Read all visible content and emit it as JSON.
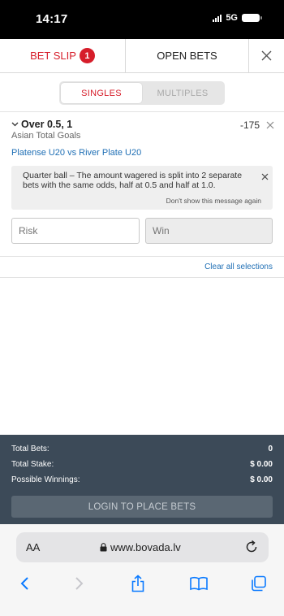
{
  "status_bar": {
    "time": "14:17",
    "network": "5G"
  },
  "tabs": {
    "bet_slip_label": "BET SLIP",
    "bet_slip_count": "1",
    "open_bets_label": "OPEN BETS"
  },
  "bet_type": {
    "singles_label": "SINGLES",
    "multiples_label": "MULTIPLES",
    "selected": "SINGLES"
  },
  "selection": {
    "title": "Over 0.5, 1",
    "odds": "-175",
    "market": "Asian Total Goals",
    "event": "Platense U20 vs River Plate U20"
  },
  "notice": {
    "text": "Quarter ball – The amount wagered is split into 2 separate bets with the same odds, half at 0.5 and half at 1.0.",
    "dismiss_label": "Don't show this message again"
  },
  "stake_inputs": {
    "risk_placeholder": "Risk",
    "risk_value": "",
    "win_placeholder": "Win",
    "win_value": ""
  },
  "clear_all_label": "Clear all selections",
  "summary": {
    "total_bets_label": "Total Bets:",
    "total_bets_value": "0",
    "total_stake_label": "Total Stake:",
    "total_stake_value": "$ 0.00",
    "possible_winnings_label": "Possible Winnings:",
    "possible_winnings_value": "$ 0.00",
    "login_button_label": "LOGIN TO PLACE BETS"
  },
  "browser": {
    "text_size_label": "AA",
    "url": "www.bovada.lv"
  },
  "colors": {
    "accent_red": "#d61d2a",
    "link_blue": "#1f6fb5",
    "summary_bg": "#3c4a58",
    "ios_blue": "#0a7aff"
  },
  "icons": [
    "close-icon",
    "chevron-down-icon",
    "lock-icon",
    "reload-icon",
    "back-icon",
    "forward-icon",
    "share-icon",
    "bookmarks-icon",
    "tabs-icon"
  ]
}
